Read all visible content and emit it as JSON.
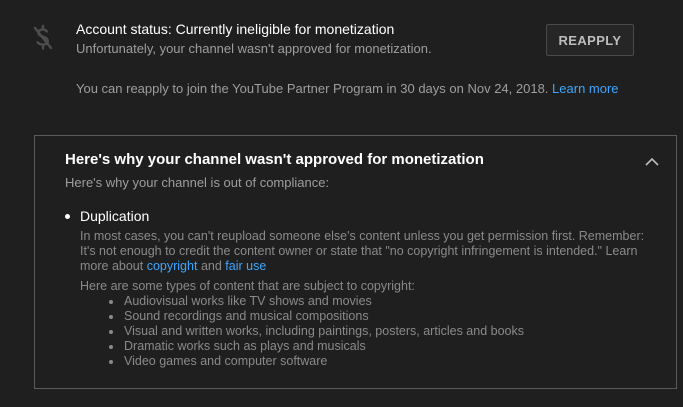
{
  "account_status": {
    "icon": "no-monetization-icon",
    "title": "Account status: Currently ineligible for monetization",
    "description": "Unfortunately, your channel wasn't approved for monetization.",
    "reapply_button": "REAPPLY",
    "reapply_note": "You can reapply to join the YouTube Partner Program in 30 days on Nov 24, 2018.",
    "learn_more": "Learn more"
  },
  "reasons_panel": {
    "title": "Here's why your channel wasn't approved for monetization",
    "subtitle": "Here's why your channel is out of compliance:",
    "collapse_icon": "chevron-up-icon",
    "reasons": [
      {
        "title": "Duplication",
        "body_line_1": "In most cases, you can't reupload someone else's content unless you get permission first. Remember:",
        "body_line_2": "It's not enough to credit the content owner or state that \"no copyright infringement is intended.\" Learn",
        "body_prefix": "more about",
        "link_copyright": "copyright",
        "and_word": "and",
        "link_fair_use": "fair use",
        "types_intro": "Here are some types of content that are subject to copyright:",
        "types": [
          "Audiovisual works like TV shows and movies",
          "Sound recordings and musical compositions",
          "Visual and written works, including paintings, posters, articles and books",
          "Dramatic works such as plays and musicals",
          "Video games and computer software"
        ]
      }
    ]
  },
  "colors": {
    "background": "#1f1f1f",
    "link": "#3ea6ff",
    "border": "#5a5a5a"
  }
}
